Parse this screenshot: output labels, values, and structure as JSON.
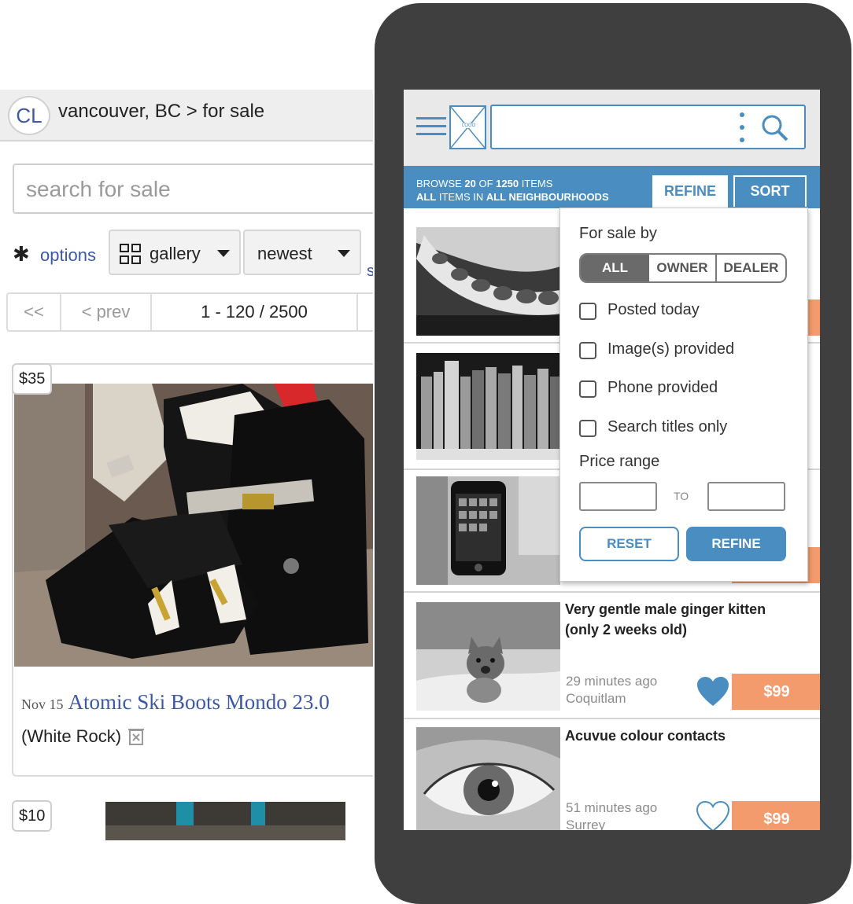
{
  "desktop": {
    "logo": "CL",
    "breadcrumb": "vancouver, BC > for sale",
    "search_placeholder": "search for sale",
    "options_label": "options",
    "view_label": "gallery",
    "sort_label": "newest",
    "side_link": "s",
    "pager": {
      "first": "<<",
      "prev": "< prev",
      "range": "1 - 120 / 2500"
    },
    "listings": [
      {
        "price": "$35",
        "date": "Nov 15",
        "title": "Atomic Ski Boots Mondo 23.0",
        "location": "(White Rock)"
      },
      {
        "price": "$10"
      }
    ]
  },
  "mobile": {
    "logo_placeholder": "LOGO",
    "browse": {
      "prefix": "BROWSE ",
      "count": "20",
      "mid": " OF ",
      "total": "1250",
      "suffix": " ITEMS"
    },
    "scope": {
      "prefix": "ALL",
      "mid": " ITEMS IN ",
      "value": "ALL NEIGHBOURHOODS"
    },
    "tabs": {
      "refine": "REFINE",
      "sort": "SORT"
    },
    "refine_panel": {
      "for_sale_by_label": "For sale by",
      "segments": [
        "ALL",
        "OWNER",
        "DEALER"
      ],
      "selected_segment": "ALL",
      "checkboxes": [
        "Posted today",
        "Image(s) provided",
        "Phone provided",
        "Search titles only"
      ],
      "price_range_label": "Price range",
      "to_label": "TO",
      "reset_label": "RESET",
      "refine_label": "REFINE"
    },
    "listings": [
      {
        "title": "Very gentle male ginger kitten (only 2 weeks old)",
        "time": "29 minutes ago",
        "location": "Coquitlam",
        "price": "$99",
        "favorited": true
      },
      {
        "title": "Acuvue colour contacts",
        "time": "51 minutes ago",
        "location": "Surrey",
        "price": "$99",
        "favorited": false
      }
    ]
  },
  "colors": {
    "accent_blue": "#4a8dc0",
    "price_orange": "#f39b6c",
    "link_blue": "#3d59a6",
    "phone_frame": "#3f3f3f"
  }
}
